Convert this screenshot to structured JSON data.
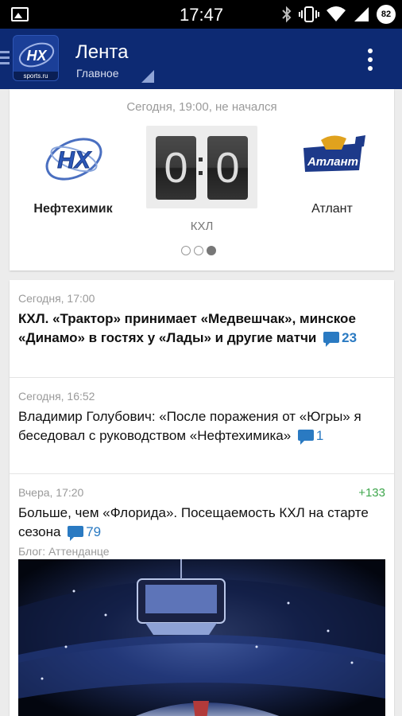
{
  "status_bar": {
    "time": "17:47",
    "battery": "82",
    "icons": [
      "gallery-icon",
      "bluetooth-icon",
      "vibrate-icon",
      "wifi-icon",
      "signal-icon",
      "battery-icon"
    ]
  },
  "app_bar": {
    "title": "Лента",
    "subtitle": "Главное",
    "logo_text": "HX",
    "logo_sub": "sports.ru"
  },
  "match": {
    "status": "Сегодня, 19:00, не начался",
    "home_team": "Нефтехимик",
    "away_team": "Атлант",
    "home_logo_text": "HX",
    "away_logo_text": "Атлант",
    "home_score": "0",
    "away_score": "0",
    "league": "КХЛ",
    "pager_count": 3,
    "pager_active_index": 2
  },
  "news": [
    {
      "time": "Сегодня, 17:00",
      "headline": "КХЛ. «Трактор» принимает «Медвешчак», минское «Динамо» в гостях у «Лады» и другие матчи",
      "comments": "23",
      "bold": true
    },
    {
      "time": "Сегодня, 16:52",
      "headline": "Владимир Голубович: «После поражения от «Югры» я беседовал с руководством «Нефтехимика»",
      "comments": "1",
      "bold": false
    },
    {
      "time": "Вчера, 17:20",
      "headline": "Больше, чем «Флорида». Посещаемость КХЛ на старте сезона",
      "comments": "79",
      "rating": "+133",
      "blog": "Блог: Аттенданце",
      "bold": false
    }
  ],
  "colors": {
    "app_bar": "#0d2a73",
    "comment_accent": "#2a7ac2",
    "rating_positive": "#3ea64c"
  }
}
